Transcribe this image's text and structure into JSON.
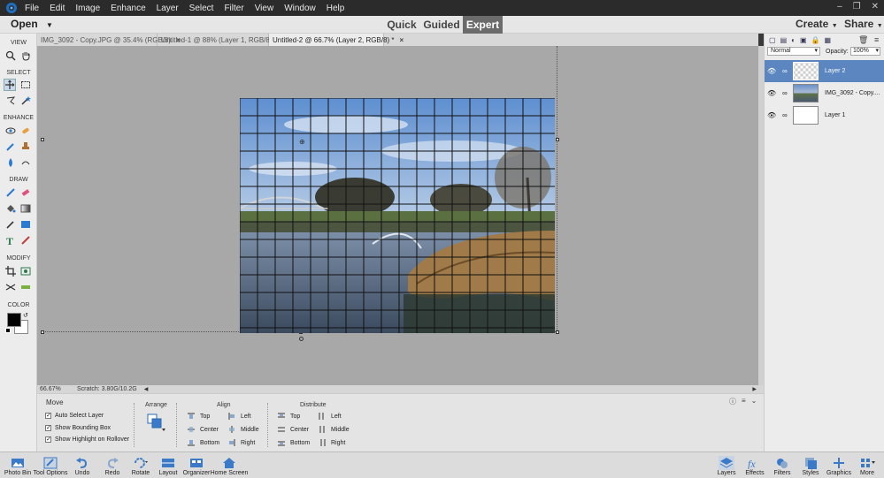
{
  "menubar": {
    "items": [
      "File",
      "Edit",
      "Image",
      "Enhance",
      "Layer",
      "Select",
      "Filter",
      "View",
      "Window",
      "Help"
    ]
  },
  "topbar": {
    "open_label": "Open",
    "modes": [
      "Quick",
      "Guided",
      "Expert"
    ],
    "active_mode": "Expert",
    "create_label": "Create",
    "share_label": "Share"
  },
  "doc_tabs": [
    {
      "title": "IMG_3092 - Copy.JPG @ 35.4% (RGB/8)",
      "active": false
    },
    {
      "title": "Untitled-1 @ 88% (Layer 1, RGB/8) *",
      "active": false
    },
    {
      "title": "Untitled-2 @ 66.7% (Layer 2, RGB/8) *",
      "active": true
    }
  ],
  "toolbar": {
    "sections": [
      "VIEW",
      "SELECT",
      "ENHANCE",
      "DRAW",
      "MODIFY",
      "COLOR"
    ]
  },
  "status": {
    "zoom": "66.67%",
    "scratch": "Scratch: 3.80G/10.2G"
  },
  "options": {
    "tool_name": "Move",
    "checkboxes": [
      "Auto Select Layer",
      "Show Bounding Box",
      "Show Highlight on Rollover"
    ],
    "arrange_label": "Arrange",
    "align_label": "Align",
    "align": [
      "Top",
      "Center",
      "Bottom",
      "Left",
      "Middle",
      "Right"
    ],
    "distribute_label": "Distribute",
    "distribute": [
      "Top",
      "Center",
      "Bottom",
      "Left",
      "Middle",
      "Right"
    ]
  },
  "layers_panel": {
    "blend_mode": "Normal",
    "opacity_label": "Opacity:",
    "opacity_value": "100%",
    "layers": [
      {
        "name": "Layer 2",
        "selected": true
      },
      {
        "name": "IMG_3092 - Copy....",
        "selected": false
      },
      {
        "name": "Layer 1",
        "selected": false
      }
    ]
  },
  "bottombar": {
    "left": [
      "Photo Bin",
      "Tool Options",
      "Undo",
      "Redo",
      "Rotate",
      "Layout",
      "Organizer",
      "Home Screen"
    ],
    "right": [
      "Layers",
      "Effects",
      "Filters",
      "Styles",
      "Graphics",
      "More"
    ]
  },
  "colors": {
    "accent": "#5b86c0",
    "expert_tab": "#6b6b6b",
    "canvas_bg": "#a8a8a8"
  }
}
